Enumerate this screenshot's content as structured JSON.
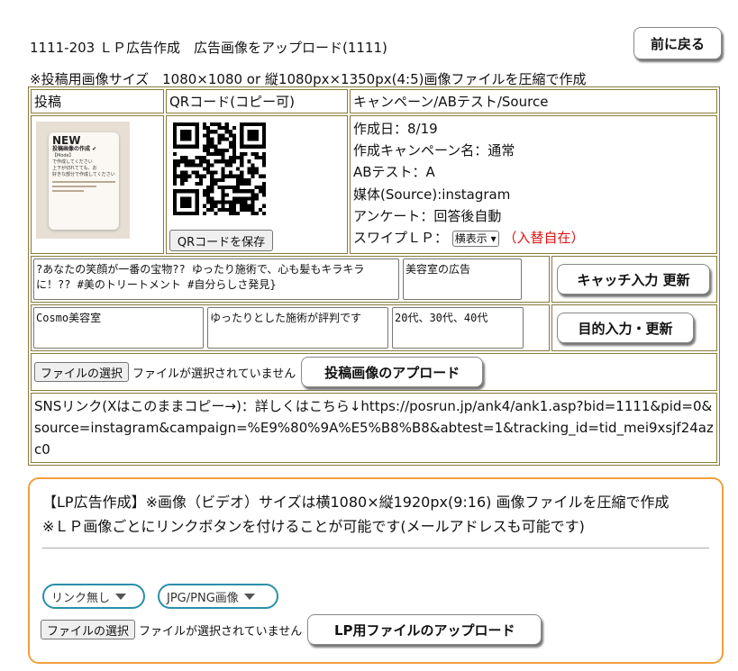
{
  "page": {
    "title": "1111-203 ＬＰ広告作成　広告画像をアップロード(1111)",
    "back_button": "前に戻る",
    "size_note": "※投稿用画像サイズ　1080×1080 or 縦1080px×1350px(4:5)画像ファイルを圧縮で作成"
  },
  "table": {
    "headers": [
      "投稿",
      "QRコード(コピー可)",
      "キャンペーン/ABテスト/Source"
    ],
    "thumbnail": {
      "new": "NEW",
      "line1": "投稿画像の作成 ✔",
      "line2": "【Mode】",
      "line3": "で作成してください",
      "line4": "上下が切れてても、お",
      "line5": "好きな部分で作成してください"
    },
    "qr_button": "QRコードを保存",
    "info": {
      "created": "作成日：8/19",
      "campaign": "作成キャンペーン名：通常",
      "abtest": "ABテスト：A",
      "source": "媒体(Source):instagram",
      "survey": "アンケート：回答後自動",
      "swipe_label": "スワイプＬＰ：",
      "swipe_select": "横表示",
      "swipe_note": "（入替自在）"
    },
    "catch_text": "?あなたの笑顔が一番の宝物?? ゆったり施術で、心も髪もキラキラに！?? #美のトリートメント #自分らしさ発見}",
    "catch_tag": "美容室の広告",
    "catch_button": "キャッチ入力 更新",
    "target_name": "Cosmo美容室",
    "target_feature": "ゆったりとした施術が評判です",
    "target_age": "20代、30代、40代",
    "target_button": "目的入力・更新",
    "file_button": "ファイルの選択",
    "file_status": "ファイルが選択されていません",
    "upload_button": "投稿画像のアプロード",
    "sns_link": "SNSリンク(Xはこのままコピー→)：詳しくはこちら↓https://posrun.jp/ank4/ank1.asp?bid=1111&pid=0&source=instagram&campaign=%E9%80%9A%E5%B8%B8&abtest=1&tracking_id=tid_mei9xsjf24azc0"
  },
  "lp": {
    "line1": "【LP広告作成】※画像（ビデオ）サイズは横1080×縦1920px(9:16) 画像ファイルを圧縮で作成",
    "line2": "※ＬＰ画像ごとにリンクボタンを付けることが可能です(メールアドレスも可能です)",
    "link_select": "リンク無し",
    "type_select": "JPG/PNG画像",
    "file_button": "ファイルの選択",
    "file_status": "ファイルが選択されていません",
    "upload_button": "LP用ファイルのアップロード"
  }
}
